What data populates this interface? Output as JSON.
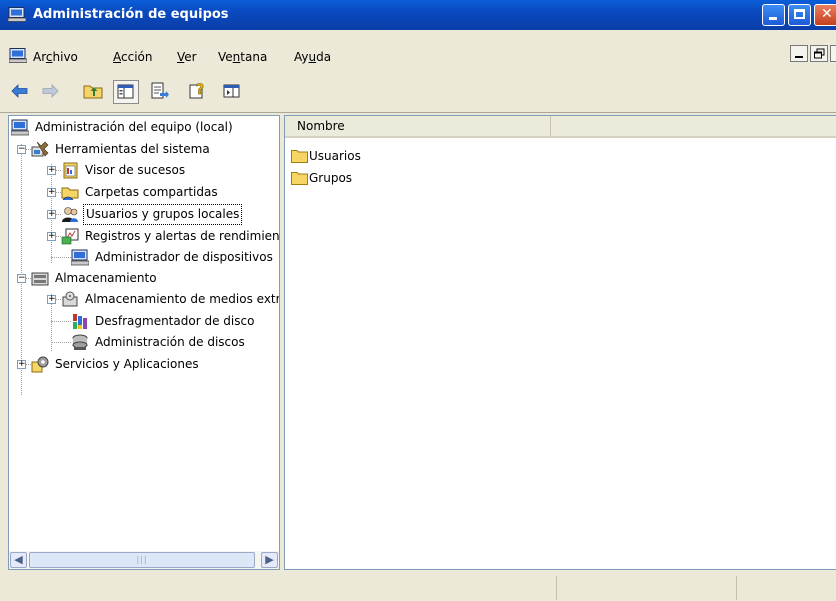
{
  "window": {
    "title": "Administración de equipos"
  },
  "menu": {
    "items": [
      {
        "pre": "Ar",
        "ul": "c",
        "post": "hivo"
      },
      {
        "pre": "",
        "ul": "A",
        "post": "cción"
      },
      {
        "pre": "",
        "ul": "V",
        "post": "er"
      },
      {
        "pre": "Ve",
        "ul": "n",
        "post": "tana"
      },
      {
        "pre": "Ay",
        "ul": "u",
        "post": "da"
      }
    ]
  },
  "toolbar": {
    "icons": [
      "back-arrow-icon",
      "forward-arrow-icon",
      "up-folder-icon",
      "show-hide-tree-icon",
      "export-list-icon",
      "help-icon",
      "action-pane-icon"
    ]
  },
  "tree": {
    "root": "Administración del equipo (local)",
    "system_tools": "Herramientas del sistema",
    "event_viewer": "Visor de sucesos",
    "shared_folders": "Carpetas compartidas",
    "local_users": "Usuarios y grupos locales",
    "perf_logs": "Registros y alertas de rendimiento",
    "device_manager": "Administrador de dispositivos",
    "storage": "Almacenamiento",
    "removable_storage": "Almacenamiento de medios extraíbles",
    "defrag": "Desfragmentador de disco",
    "disk_mgmt": "Administración de discos",
    "services_apps": "Servicios y Aplicaciones",
    "selected": "Usuarios y grupos locales"
  },
  "list": {
    "column_name": "Nombre",
    "items": [
      "Usuarios",
      "Grupos"
    ]
  },
  "colors": {
    "titlebar": "#0A49BF",
    "face": "#ECE9D8",
    "folder": "#F5D564"
  }
}
